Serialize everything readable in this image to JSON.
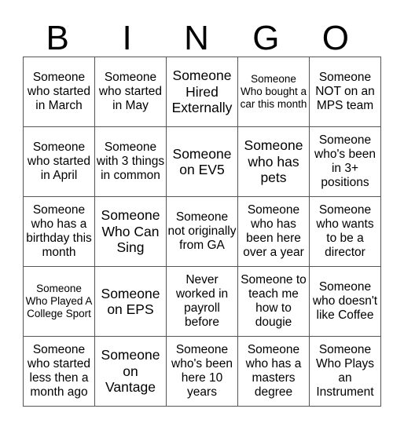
{
  "title_letters": [
    "B",
    "I",
    "N",
    "G",
    "O"
  ],
  "rows": [
    [
      "Someone who started in March",
      "Someone who started in May",
      "Someone Hired Externally",
      "Someone Who bought a car this month",
      "Someone NOT on an MPS team"
    ],
    [
      "Someone who started in April",
      "Someone with 3 things in common",
      "Someone on EV5",
      "Someone who has pets",
      "Someone who's been in 3+ positions"
    ],
    [
      "Someone who has a birthday this month",
      "Someone Who Can Sing",
      "Someone not originally from GA",
      "Someone who has been here over a year",
      "Someone who wants to be a director"
    ],
    [
      "Someone Who Played A College Sport",
      "Someone on EPS",
      "Never worked in payroll before",
      "Someone to teach me how to dougie",
      "Someone who doesn't like Coffee"
    ],
    [
      "Someone who started less then a month ago",
      "Someone on Vantage",
      "Someone who's been here 10 years",
      "Someone who has a masters degree",
      "Someone Who Plays an Instrument"
    ]
  ]
}
